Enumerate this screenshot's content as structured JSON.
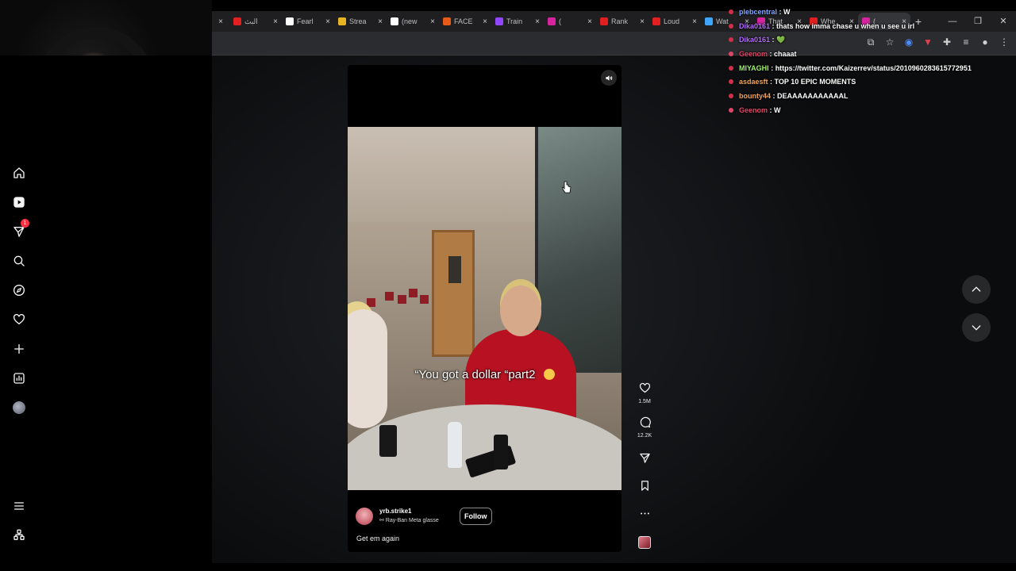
{
  "browser": {
    "tabs": [
      {
        "title": "",
        "favicon_color": "#444444"
      },
      {
        "title": "البث",
        "favicon_color": "#e02020"
      },
      {
        "title": "Fearl",
        "favicon_color": "#ffffff"
      },
      {
        "title": "Strea",
        "favicon_color": "#e7b521"
      },
      {
        "title": "(new",
        "favicon_color": "#ffffff"
      },
      {
        "title": "FACE",
        "favicon_color": "#e85a1a"
      },
      {
        "title": "Train",
        "favicon_color": "#9146ff"
      },
      {
        "title": "(",
        "favicon_color": "#d6249f"
      },
      {
        "title": "Rank",
        "favicon_color": "#e02020"
      },
      {
        "title": "Loud",
        "favicon_color": "#e02020"
      },
      {
        "title": "Wat",
        "favicon_color": "#3ea6ff"
      },
      {
        "title": "That",
        "favicon_color": "#d6249f"
      },
      {
        "title": "Whe",
        "favicon_color": "#e02020"
      },
      {
        "title": "(",
        "favicon_color": "#d6249f"
      }
    ],
    "active_tab_index": 13,
    "close_glyph": "×",
    "new_tab_glyph": "+",
    "window_controls": [
      "—",
      "❐",
      "✕"
    ]
  },
  "sidebar": {
    "items": [
      {
        "name": "home-icon"
      },
      {
        "name": "reels-icon"
      },
      {
        "name": "messages-icon",
        "badge": "1"
      },
      {
        "name": "search-icon"
      },
      {
        "name": "explore-icon"
      },
      {
        "name": "notifications-icon"
      },
      {
        "name": "create-icon"
      },
      {
        "name": "dashboard-icon"
      },
      {
        "name": "profile-avatar"
      }
    ],
    "bottom": [
      {
        "name": "menu-icon"
      },
      {
        "name": "also-from-meta-icon"
      }
    ]
  },
  "reel": {
    "overlay_caption": "“You got a dollar “part2",
    "username": "yrb.strike1",
    "audio_label": "Ray-Ban Meta glasse",
    "follow_label": "Follow",
    "caption": "Get em again",
    "likes": "1.5M",
    "comments": "12.2K"
  },
  "chat": [
    {
      "user": "plebcentral",
      "color": "#7fa6ff",
      "dot": "#d0304a",
      "message": "W"
    },
    {
      "user": "Dika0161",
      "color": "#b46bff",
      "dot": "#d0304a",
      "message": "thats how imma chase u when u see u irl"
    },
    {
      "user": "Dika0161",
      "color": "#b46bff",
      "dot": "#d0304a",
      "message": "💚"
    },
    {
      "user": "Geenom",
      "color": "#e0476a",
      "dot": "#e0476a",
      "message": "chaaat"
    },
    {
      "user": "MIYAGHI",
      "color": "#9ef06a",
      "dot": "#d0304a",
      "message": "https://twitter.com/Kaizerrev/status/2010960283615772951"
    },
    {
      "user": "asdaesft",
      "color": "#f0a35e",
      "dot": "#d0304a",
      "message": "TOP 10 EPIC MOMENTS"
    },
    {
      "user": "bounty44",
      "color": "#f0a35e",
      "dot": "#d0304a",
      "message": "DEAAAAAAAAAAAL"
    },
    {
      "user": "Geenom",
      "color": "#e0476a",
      "dot": "#e0476a",
      "message": "W"
    }
  ],
  "chat_separator": " : "
}
